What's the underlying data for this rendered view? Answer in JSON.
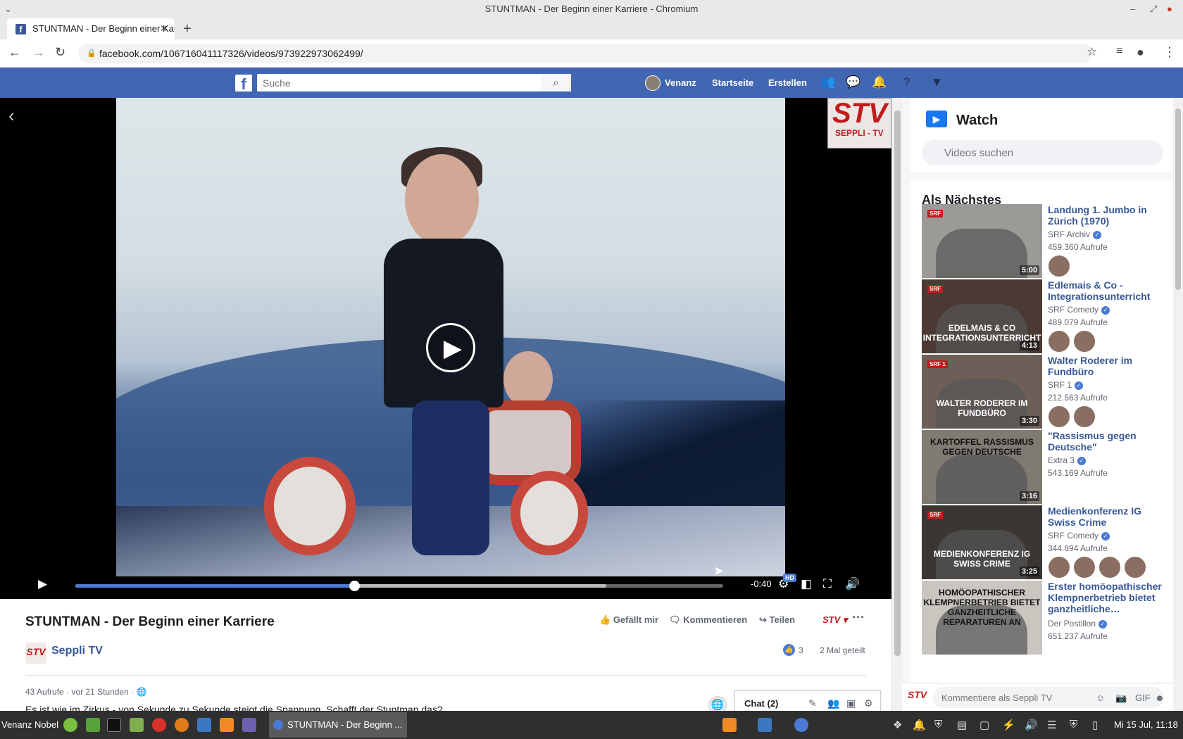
{
  "browser": {
    "window_title": "STUNTMAN - Der Beginn einer Karriere - Chromium",
    "tab_title": "STUNTMAN - Der Beginn einer Karriere",
    "url": "facebook.com/106716041117326/videos/973922973062499/"
  },
  "fb": {
    "search_placeholder": "Suche",
    "user": "Venanz",
    "nav_home": "Startseite",
    "nav_create": "Erstellen"
  },
  "video": {
    "overlay_logo_big": "STV",
    "overlay_logo_small": "SEPPLI - TV",
    "progress_played": 0.43,
    "progress_buffered": 0.82,
    "time_left": "-0:40",
    "hd_badge": "HD",
    "title": "STUNTMAN - Der Beginn einer Karriere",
    "like_label": "Gefällt mir",
    "comment_label": "Kommentieren",
    "share_label": "Teilen",
    "page_avatar": "STV",
    "page_name": "Seppli TV",
    "likes_count": "3",
    "shares": "2 Mal geteilt",
    "views": "43 Aufrufe",
    "time_ago": "vor 21 Stunden",
    "description": "Es ist wie im Zirkus - von Sekunde zu Sekunde steigt die Spannung. Schafft der Stuntman das?"
  },
  "chat": {
    "label": "Chat (2)"
  },
  "watch": {
    "title": "Watch",
    "search_placeholder": "Videos suchen",
    "next_label": "Als Nächstes",
    "items": [
      {
        "title": "Landung 1. Jumbo in Zürich (1970)",
        "channel": "SRF Archiv",
        "views": "459.360 Aufrufe",
        "duration": "5:00",
        "thumb_text": "",
        "badge": "SRF",
        "friends": 1,
        "bg": "#9c9a96"
      },
      {
        "title": "Edlemais & Co - Integrationsunterricht",
        "channel": "SRF Comedy",
        "views": "489.079 Aufrufe",
        "duration": "4:13",
        "thumb_text": "EDELMAIS & CO INTEGRATIONSUNTERRICHT",
        "badge": "SRF",
        "friends": 2,
        "bg": "#4a3a33"
      },
      {
        "title": "Walter Roderer im Fundbüro",
        "channel": "SRF 1",
        "views": "212.563 Aufrufe",
        "duration": "3:30",
        "thumb_text": "WALTER RODERER IM FUNDBÜRO",
        "badge": "SRF 1",
        "friends": 2,
        "bg": "#6b5f57"
      },
      {
        "title": "\"Rassismus gegen Deutsche\"",
        "channel": "Extra 3",
        "views": "543.169 Aufrufe",
        "duration": "3:16",
        "thumb_text": "KARTOFFEL RASSISMUS GEGEN DEUTSCHE",
        "badge": "",
        "friends": 0,
        "bg": "#7f7a72"
      },
      {
        "title": "Medienkonferenz IG Swiss Crime",
        "channel": "SRF Comedy",
        "views": "344.894 Aufrufe",
        "duration": "3:25",
        "thumb_text": "MEDIENKONFERENZ IG SWISS CRIME",
        "badge": "SRF",
        "friends": 4,
        "bg": "#3a3633"
      },
      {
        "title": "Erster homöopathischer Klempnerbetrieb bietet ganzheitliche…",
        "channel": "Der Postillon",
        "views": "651.237 Aufrufe",
        "duration": "",
        "thumb_text": "HOMÖOPATHISCHER KLEMPNERBETRIEB BIETET GANZHEITLICHE REPARATUREN AN",
        "badge": "",
        "friends": 0,
        "bg": "#c9c5bf"
      }
    ]
  },
  "comment": {
    "avatar": "STV",
    "placeholder": "Kommentiere als Seppli TV"
  },
  "taskbar": {
    "user": "Venanz Nobel",
    "window": "STUNTMAN - Der Beginn ...",
    "clock": "Mi 15 Jul, 11:18"
  }
}
